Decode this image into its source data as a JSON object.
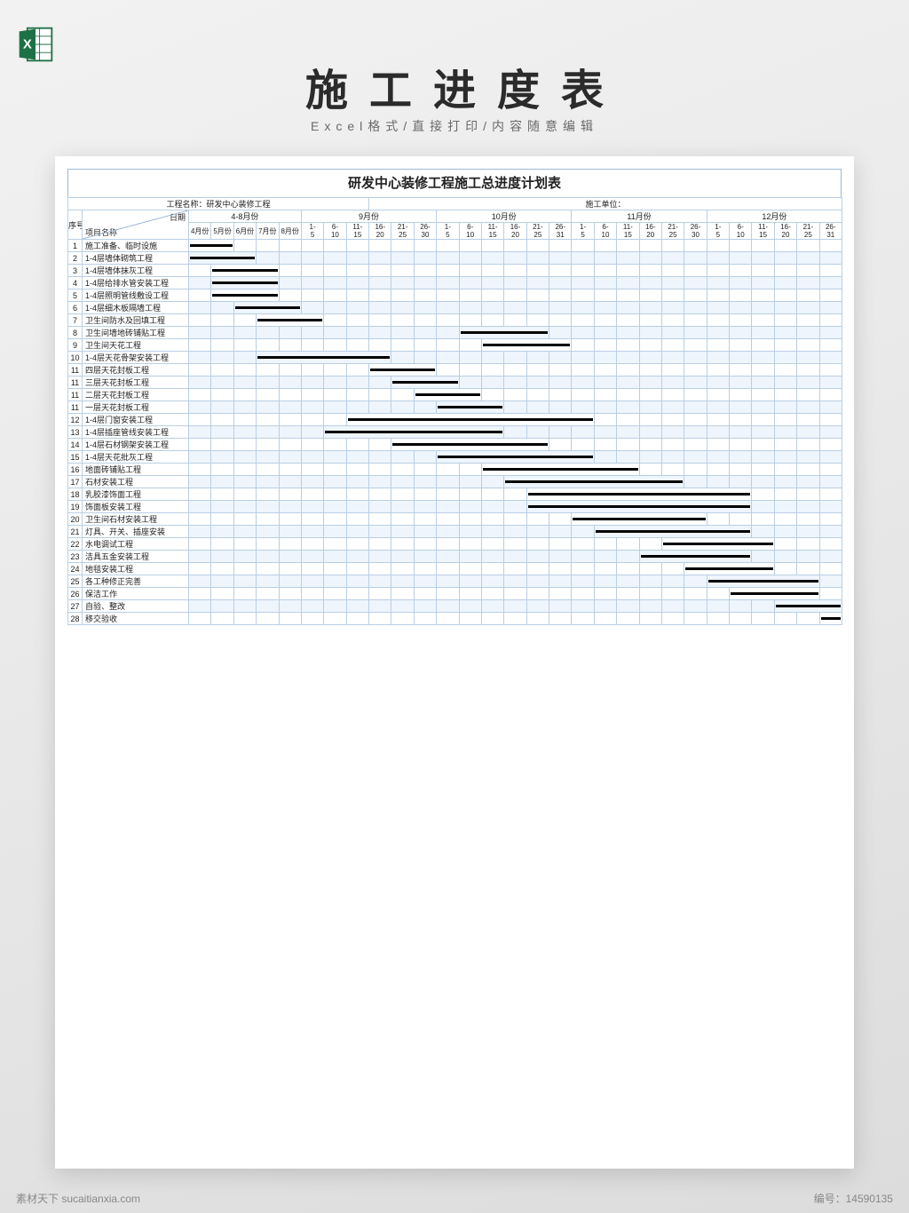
{
  "page": {
    "title": "施工进度表",
    "subtitle": "Excel格式/直接打印/内容随意编辑"
  },
  "footer": {
    "left": "素材天下 sucaitianxia.com",
    "right": "编号：14590135"
  },
  "sheet": {
    "title": "研发中心装修工程施工总进度计划表",
    "proj_name_label": "工程名称：研发中心装修工程",
    "unit_label": "施工单位：",
    "seq_label": "序号",
    "item_label": "项目名称",
    "date_label": "日期",
    "month_groups": [
      {
        "label": "4-8月份",
        "subs": [
          "4月份",
          "5月份",
          "6月份",
          "7月份",
          "8月份"
        ]
      },
      {
        "label": "9月份",
        "subs": [
          "1-5",
          "6-10",
          "11-15",
          "16-20",
          "21-25",
          "26-30"
        ]
      },
      {
        "label": "10月份",
        "subs": [
          "1-5",
          "6-10",
          "11-15",
          "16-20",
          "21-25",
          "26-31"
        ]
      },
      {
        "label": "11月份",
        "subs": [
          "1-5",
          "6-10",
          "11-15",
          "16-20",
          "21-25",
          "26-30"
        ]
      },
      {
        "label": "12月份",
        "subs": [
          "1-5",
          "6-10",
          "11-15",
          "16-20",
          "21-25",
          "26-31"
        ]
      }
    ]
  },
  "chart_data": {
    "type": "bar",
    "title": "研发中心装修工程施工总进度计划表",
    "xlabel": "日期",
    "ylabel": "项目名称",
    "categories_note": "29 time slots: slots 0-4 are months 4-8; slots 5-10=Sep 5-day blocks; 11-16=Oct; 17-22=Nov; 23-28=Dec",
    "tasks": [
      {
        "seq": 1,
        "name": "施工准备、临时设施",
        "start": 0,
        "end": 1
      },
      {
        "seq": 2,
        "name": "1-4层墙体砌筑工程",
        "start": 0,
        "end": 2
      },
      {
        "seq": 3,
        "name": "1-4层墙体抹灰工程",
        "start": 1,
        "end": 3
      },
      {
        "seq": 4,
        "name": "1-4层给排水管安装工程",
        "start": 1,
        "end": 3
      },
      {
        "seq": 5,
        "name": "1-4层照明管线敷设工程",
        "start": 1,
        "end": 3
      },
      {
        "seq": 6,
        "name": "1-4层细木板隔墙工程",
        "start": 2,
        "end": 4
      },
      {
        "seq": 7,
        "name": "卫生间防水及回填工程",
        "start": 3,
        "end": 5
      },
      {
        "seq": 8,
        "name": "卫生间墙地砖铺贴工程",
        "start": 12,
        "end": 15
      },
      {
        "seq": 9,
        "name": "卫生间天花工程",
        "start": 13,
        "end": 16
      },
      {
        "seq": 10,
        "name": "1-4层天花骨架安装工程",
        "start": 3,
        "end": 8
      },
      {
        "seq": 11,
        "name": "四层天花封板工程",
        "start": 8,
        "end": 10
      },
      {
        "seq": 11,
        "name": "三层天花封板工程",
        "start": 9,
        "end": 11
      },
      {
        "seq": 11,
        "name": "二层天花封板工程",
        "start": 10,
        "end": 12
      },
      {
        "seq": 11,
        "name": "一层天花封板工程",
        "start": 11,
        "end": 13
      },
      {
        "seq": 12,
        "name": "1-4层门窗安装工程",
        "start": 7,
        "end": 17
      },
      {
        "seq": 13,
        "name": "1-4层插座管线安装工程",
        "start": 6,
        "end": 13
      },
      {
        "seq": 14,
        "name": "1-4层石材钢架安装工程",
        "start": 9,
        "end": 15
      },
      {
        "seq": 15,
        "name": "1-4层天花批灰工程",
        "start": 11,
        "end": 17
      },
      {
        "seq": 16,
        "name": "地面砖铺贴工程",
        "start": 13,
        "end": 19
      },
      {
        "seq": 17,
        "name": "石材安装工程",
        "start": 14,
        "end": 21
      },
      {
        "seq": 18,
        "name": "乳胶漆饰面工程",
        "start": 15,
        "end": 24
      },
      {
        "seq": 19,
        "name": "饰面板安装工程",
        "start": 15,
        "end": 24
      },
      {
        "seq": 20,
        "name": "卫生间石材安装工程",
        "start": 17,
        "end": 22
      },
      {
        "seq": 21,
        "name": "灯具、开关、插座安装",
        "start": 18,
        "end": 24
      },
      {
        "seq": 22,
        "name": "水电调试工程",
        "start": 21,
        "end": 25
      },
      {
        "seq": 23,
        "name": "洁具五金安装工程",
        "start": 20,
        "end": 24
      },
      {
        "seq": 24,
        "name": "地毯安装工程",
        "start": 22,
        "end": 25
      },
      {
        "seq": 25,
        "name": "各工种修正完善",
        "start": 23,
        "end": 27
      },
      {
        "seq": 26,
        "name": "保洁工作",
        "start": 24,
        "end": 27
      },
      {
        "seq": 27,
        "name": "自验、整改",
        "start": 26,
        "end": 28
      },
      {
        "seq": 28,
        "name": "移交验收",
        "start": 28,
        "end": 28
      }
    ]
  }
}
